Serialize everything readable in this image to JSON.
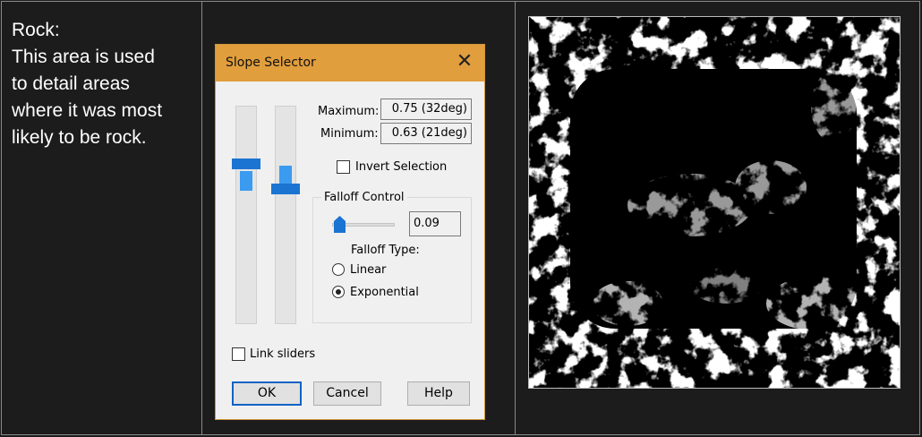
{
  "description": {
    "heading": "Rock:",
    "lines": [
      "This area is used",
      "to detail areas",
      "where it was most",
      "likely to be rock."
    ]
  },
  "dialog": {
    "title": "Slope Selector",
    "close_glyph": "✕",
    "maximum_label": "Maximum:",
    "maximum_value": "0.75 (32deg)",
    "minimum_label": "Minimum:",
    "minimum_value": "0.63 (21deg)",
    "invert_label": "Invert Selection",
    "invert_checked": false,
    "falloff_group_title": "Falloff Control",
    "falloff_value": "0.09",
    "falloff_type_label": "Falloff Type:",
    "falloff_options": [
      "Linear",
      "Exponential"
    ],
    "falloff_selected": "Exponential",
    "link_sliders_label": "Link sliders",
    "link_sliders_checked": false,
    "buttons": {
      "ok": "OK",
      "cancel": "Cancel",
      "help": "Help"
    }
  },
  "colors": {
    "titlebar": "#e19e3d",
    "slider_thumb": "#1b74d1",
    "slider_fill": "#3a9bf0",
    "page_background": "#1c1c1c"
  },
  "image": {
    "icon": "rock-slope-mask-image"
  }
}
